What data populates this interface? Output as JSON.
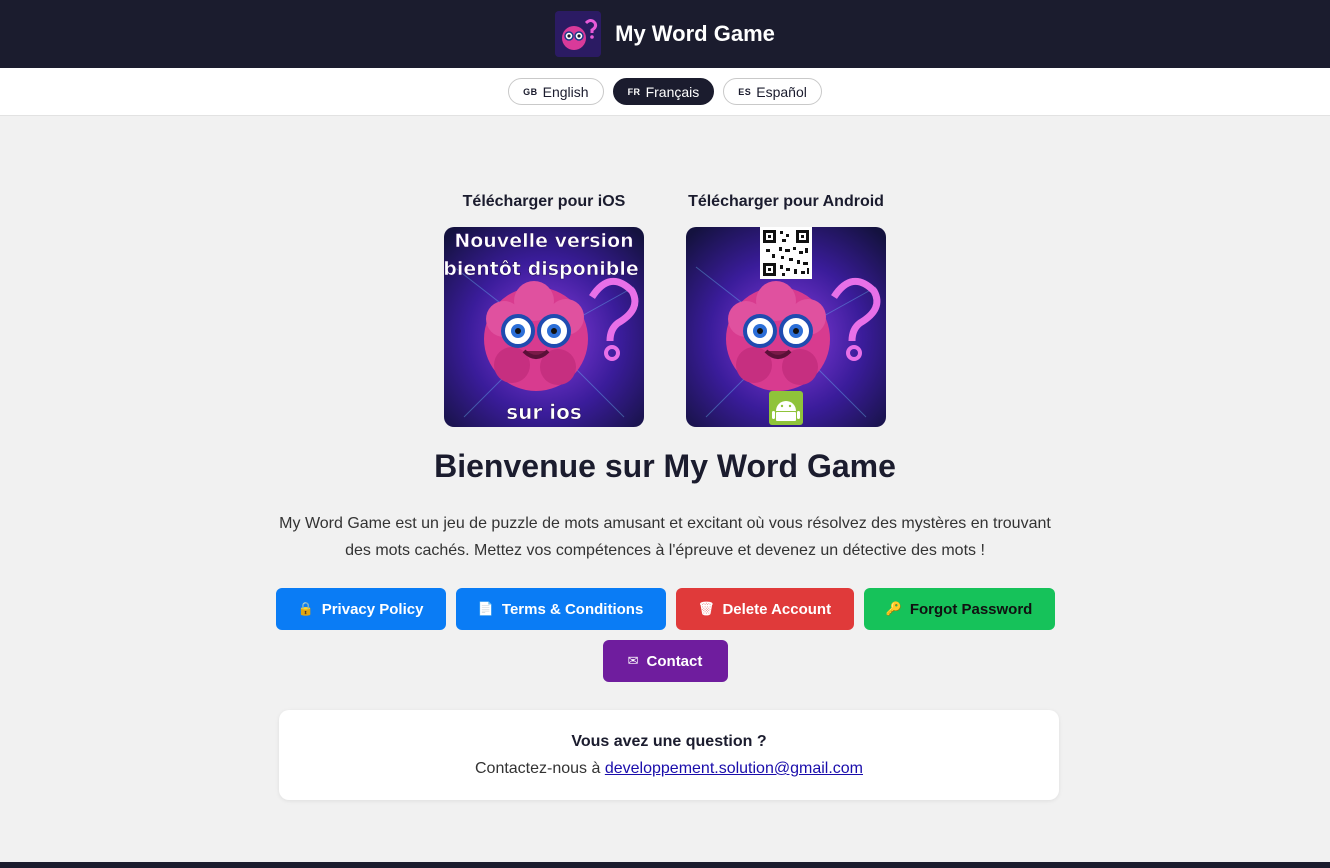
{
  "header": {
    "title": "My Word Game",
    "logo_icon": "brain-mascot-icon"
  },
  "languages": [
    {
      "code": "GB",
      "label": "English",
      "active": false
    },
    {
      "code": "FR",
      "label": "Français",
      "active": true
    },
    {
      "code": "ES",
      "label": "Español",
      "active": false
    }
  ],
  "downloads": {
    "ios": {
      "label": "Télécharger pour iOS",
      "overlay_top_line1": "Nouvelle version",
      "overlay_top_line2": "bientôt disponible",
      "overlay_bottom": "sur ios"
    },
    "android": {
      "label": "Télécharger pour Android",
      "badge_icon": "android-icon",
      "qr_icon": "qr-code-icon"
    }
  },
  "main": {
    "headline": "Bienvenue sur My Word Game",
    "description": "My Word Game est un jeu de puzzle de mots amusant et excitant où vous résolvez des mystères en trouvant des mots cachés. Mettez vos compétences à l'épreuve et devenez un détective des mots !"
  },
  "buttons": {
    "privacy": {
      "label": "Privacy Policy",
      "icon": "🔒",
      "color": "#0a7cf5"
    },
    "terms": {
      "label": "Terms & Conditions",
      "icon": "📄",
      "color": "#0a7cf5"
    },
    "delete": {
      "label": "Delete Account",
      "icon": "🗑",
      "color": "#e03a3a"
    },
    "forgot": {
      "label": "Forgot Password",
      "icon": "🔑",
      "color": "#16c25a"
    },
    "contact": {
      "label": "Contact",
      "icon": "✉",
      "color": "#6f1d9e"
    }
  },
  "question_card": {
    "title": "Vous avez une question ?",
    "prefix": "Contactez-nous à",
    "email": "developpement.solution@gmail.com"
  },
  "colors": {
    "header_bg": "#1b1c2e",
    "page_bg": "#f1f1f1",
    "link": "#1a0dab"
  }
}
